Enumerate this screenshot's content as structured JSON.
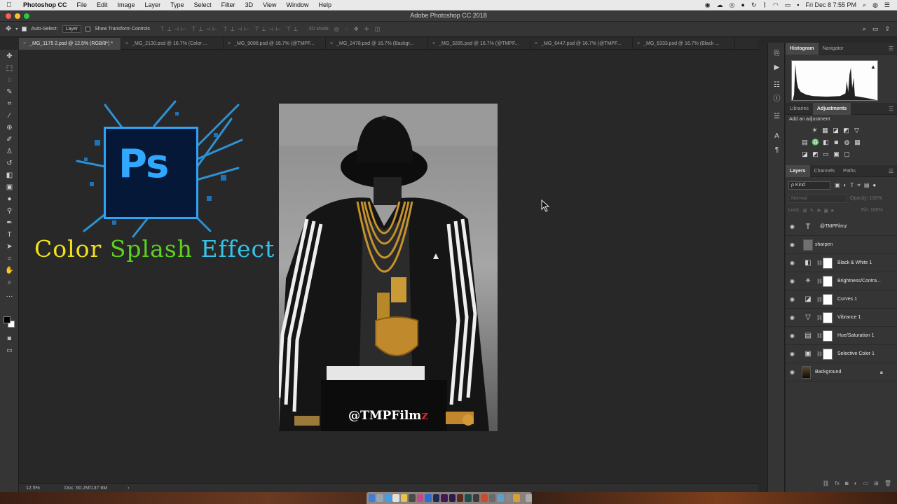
{
  "menubar": {
    "apple": "",
    "items": [
      "Photoshop CC",
      "File",
      "Edit",
      "Image",
      "Layer",
      "Type",
      "Select",
      "Filter",
      "3D",
      "View",
      "Window",
      "Help"
    ],
    "clock": "Fri Dec 8  7:55 PM",
    "right_icons": [
      "record-icon",
      "creative-cloud-icon",
      "browser-icon",
      "app-icon",
      "sync-icon",
      "bluetooth-icon",
      "wifi-icon",
      "battery-icon",
      "flag-icon",
      "search-icon",
      "user-icon",
      "list-icon"
    ]
  },
  "window": {
    "title": "Adobe Photoshop CC 2018"
  },
  "options": {
    "auto_select_label": "Auto-Select:",
    "auto_select_value": "Layer",
    "show_transform_label": "Show Transform Controls",
    "mode_3d_label": "3D Mode:"
  },
  "tabs": [
    "_MG_1175 2.psd @ 12.5% (RGB/8*) *",
    "_MG_2130.psd @ 16.7% (Color ...",
    "_MG_9086.psd @ 16.7% (@TMPF...",
    "_MG_2478.psd @ 16.7% (Backgr...",
    "_MG_3285.psd @ 16.7% (@TMPF...",
    "_MG_6447.psd @ 16.7% (@TMPF...",
    "_MG_6333.psd @ 16.7% (Black ..."
  ],
  "canvas": {
    "logo_text": "Ps",
    "headline": {
      "word1": "Color",
      "word2": "Splash",
      "word3": "Effect"
    },
    "watermark_main": "@TMPFilm",
    "watermark_accent": "z"
  },
  "status": {
    "zoom": "12.5%",
    "doc": "Doc: 60.2M/137.6M",
    "arrow": "›"
  },
  "panels": {
    "top_tabs": [
      "Histogram",
      "Navigator"
    ],
    "mid_tabs": [
      "Libraries",
      "Adjustments"
    ],
    "add_adjustment": "Add an adjustment",
    "layer_tabs": [
      "Layers",
      "Channels",
      "Paths"
    ],
    "kind_label": "ρ Kind",
    "blend_mode": "Normal",
    "opacity_label": "Opacity:",
    "opacity_value": "100%",
    "lock_label": "Lock:",
    "fill_label": "Fill:",
    "fill_value": "100%"
  },
  "layers": [
    {
      "name": "@TMPFilmz",
      "type": "text"
    },
    {
      "name": "sharpen",
      "type": "pixel"
    },
    {
      "name": "Black & White 1",
      "type": "adjustment",
      "icon": "bw-icon"
    },
    {
      "name": "Brightness/Contra...",
      "type": "adjustment",
      "icon": "sun-icon"
    },
    {
      "name": "Curves 1",
      "type": "adjustment",
      "icon": "curves-icon"
    },
    {
      "name": "Vibrance 1",
      "type": "adjustment",
      "icon": "vibrance-icon"
    },
    {
      "name": "Hue/Saturation 1",
      "type": "adjustment",
      "icon": "hue-icon"
    },
    {
      "name": "Selective Color 1",
      "type": "adjustment",
      "icon": "selective-color-icon"
    },
    {
      "name": "Background",
      "type": "background"
    }
  ],
  "colors": {
    "accent_blue": "#31a8ff",
    "headline_yellow": "#f2e21c",
    "headline_green": "#5bd21c",
    "headline_cyan": "#35c3e8"
  }
}
